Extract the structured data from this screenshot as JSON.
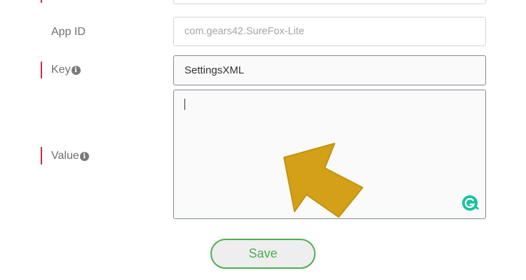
{
  "form": {
    "app_id": {
      "label": "App ID",
      "value": "com.gears42.SureFox-Lite",
      "required": false
    },
    "key": {
      "label": "Key",
      "value": "SettingsXML",
      "required": true,
      "info_icon": "info-circle-icon"
    },
    "value": {
      "label": "Value",
      "value": "",
      "required": true,
      "info_icon": "info-circle-icon",
      "extension_icon": "grammarly-icon"
    },
    "info_glyph": "i"
  },
  "actions": {
    "save_label": "Save"
  },
  "colors": {
    "required_marker": "#d7263d",
    "save_accent": "#4cae4c",
    "pointer_arrow": "#d4a017",
    "grammarly": "#15c39a"
  }
}
